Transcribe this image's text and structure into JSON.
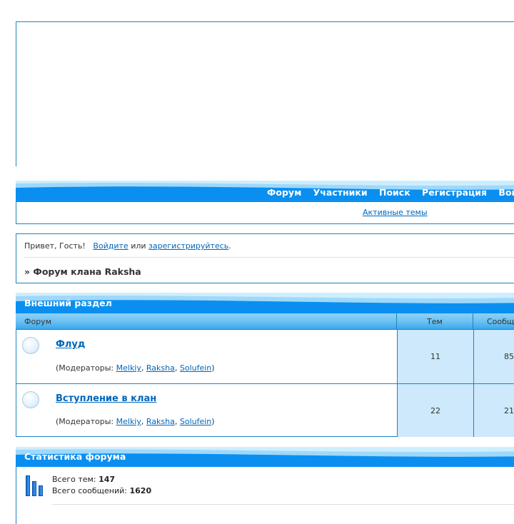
{
  "nav": {
    "items": [
      "Форум",
      "Участники",
      "Поиск",
      "Регистрация",
      "Войти"
    ],
    "sub_link": "Активные темы"
  },
  "welcome": {
    "greeting": "Привет, Гость!",
    "login_link": "Войдите",
    "or_text": "или",
    "register_link": "зарегистрируйтесь",
    "period": ".",
    "breadcrumb": "» Форум клана Raksha"
  },
  "category": {
    "title": "Внешний раздел",
    "columns": {
      "forum": "Форум",
      "topics": "Тем",
      "posts": "Сообщ"
    },
    "forums": [
      {
        "name": "Флуд",
        "mods_prefix": "(Модераторы: ",
        "moderators": [
          "Melkiy",
          "Raksha",
          "Solufein"
        ],
        "mods_suffix": ")",
        "topics": "11",
        "posts": "85"
      },
      {
        "name": "Вступление в клан",
        "mods_prefix": "(Модераторы: ",
        "moderators": [
          "Melkiy",
          "Raksha",
          "Solufein"
        ],
        "mods_suffix": ")",
        "topics": "22",
        "posts": "21"
      }
    ]
  },
  "stats": {
    "title": "Статистика форума",
    "topics_label": "Всего тем:",
    "topics_value": "147",
    "posts_label": "Всего сообщений:",
    "posts_value": "1620"
  },
  "colors": {
    "accent": "#0d8ee6",
    "border": "#1b86c1",
    "cell_blue": "#cde9fb",
    "link": "#0066bb"
  }
}
